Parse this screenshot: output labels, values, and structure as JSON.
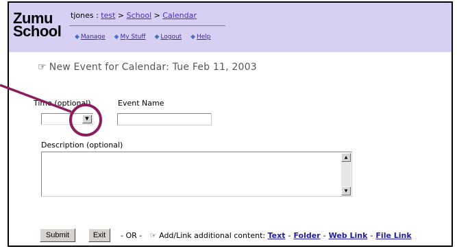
{
  "logo": {
    "line1": "Zumu",
    "line2": "School"
  },
  "breadcrumb": {
    "user": "tjones",
    "sep1": " : ",
    "link1": "test",
    "sep2": " > ",
    "link2": "School",
    "sep3": " > ",
    "link3": "Calendar"
  },
  "nav": [
    {
      "label": "Manage"
    },
    {
      "label": "My Stuff"
    },
    {
      "label": "Logout"
    },
    {
      "label": "Help"
    }
  ],
  "page_title": "New Event for Calendar: Tue  Feb 11,  2003",
  "form": {
    "time_label": "Time (optional)",
    "time_value": "",
    "event_name_label": "Event Name",
    "event_name_value": "",
    "description_label": "Description (optional)",
    "description_value": ""
  },
  "buttons": {
    "submit": "Submit",
    "exit": "Exit"
  },
  "footer": {
    "or_text": "- OR -",
    "add_text": "Add/Link additional content:",
    "links": [
      "Text",
      "Folder",
      "Web Link",
      "File Link"
    ]
  },
  "colors": {
    "header_bg": "#d8d0f4",
    "annotation": "#8b1d5c",
    "link": "#4a2ab8"
  }
}
